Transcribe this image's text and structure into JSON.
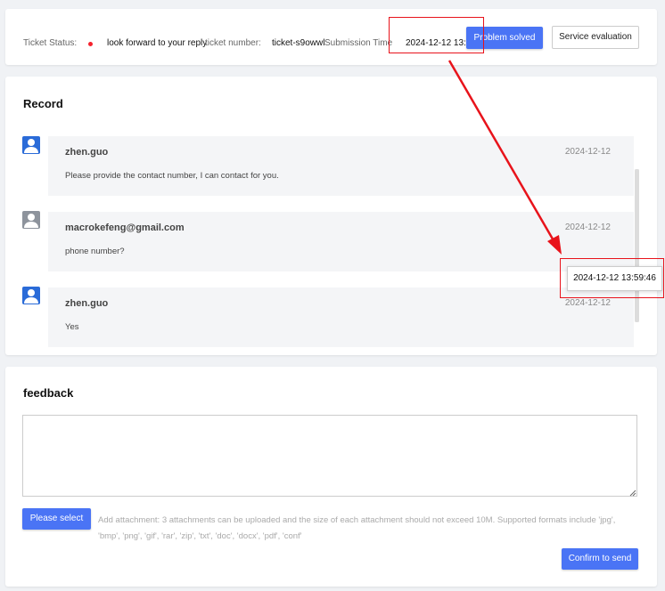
{
  "status_bar": {
    "ticket_status_label": "Ticket Status:",
    "ticket_status_value": "look forward to your reply",
    "ticket_number_label": "ticket number:",
    "ticket_number_value": "ticket-s9owwl",
    "submission_time_label": "Submission Time",
    "submission_time_value": "2024-12-12 13:5",
    "problem_solved_label": "Problem solved",
    "service_evaluation_label": "Service evaluation",
    "status_dot_color": "#f5222d"
  },
  "record": {
    "title": "Record",
    "messages": [
      {
        "author": "zhen.guo",
        "date": "2024-12-12",
        "body": "Please provide the contact number, I can contact for you.",
        "avatar_icon": "user-avatar-icon",
        "avatar_color": "#2a6bd8"
      },
      {
        "author": "macrokefeng@gmail.com",
        "date": "2024-12-12",
        "body": "phone number?",
        "avatar_icon": "user-avatar-icon",
        "avatar_color": "#8d939c"
      },
      {
        "author": "zhen.guo",
        "date": "2024-12-12",
        "body": "Yes",
        "avatar_icon": "user-avatar-icon",
        "avatar_color": "#2a6bd8"
      }
    ]
  },
  "tooltip": {
    "text": "2024-12-12 13:59:46"
  },
  "feedback": {
    "title": "feedback",
    "textarea_value": "",
    "please_select_label": "Please select",
    "attachment_note": "Add attachment: 3 attachments can be uploaded and the size of each attachment should not exceed 10M. Supported formats include 'jpg', 'bmp', 'png', 'gif', 'rar', 'zip', 'txt', 'doc', 'docx', 'pdf', 'conf'",
    "confirm_label": "Confirm to send"
  },
  "colors": {
    "primary_button": "#4a74f5",
    "annotation_red": "#e8131b"
  }
}
